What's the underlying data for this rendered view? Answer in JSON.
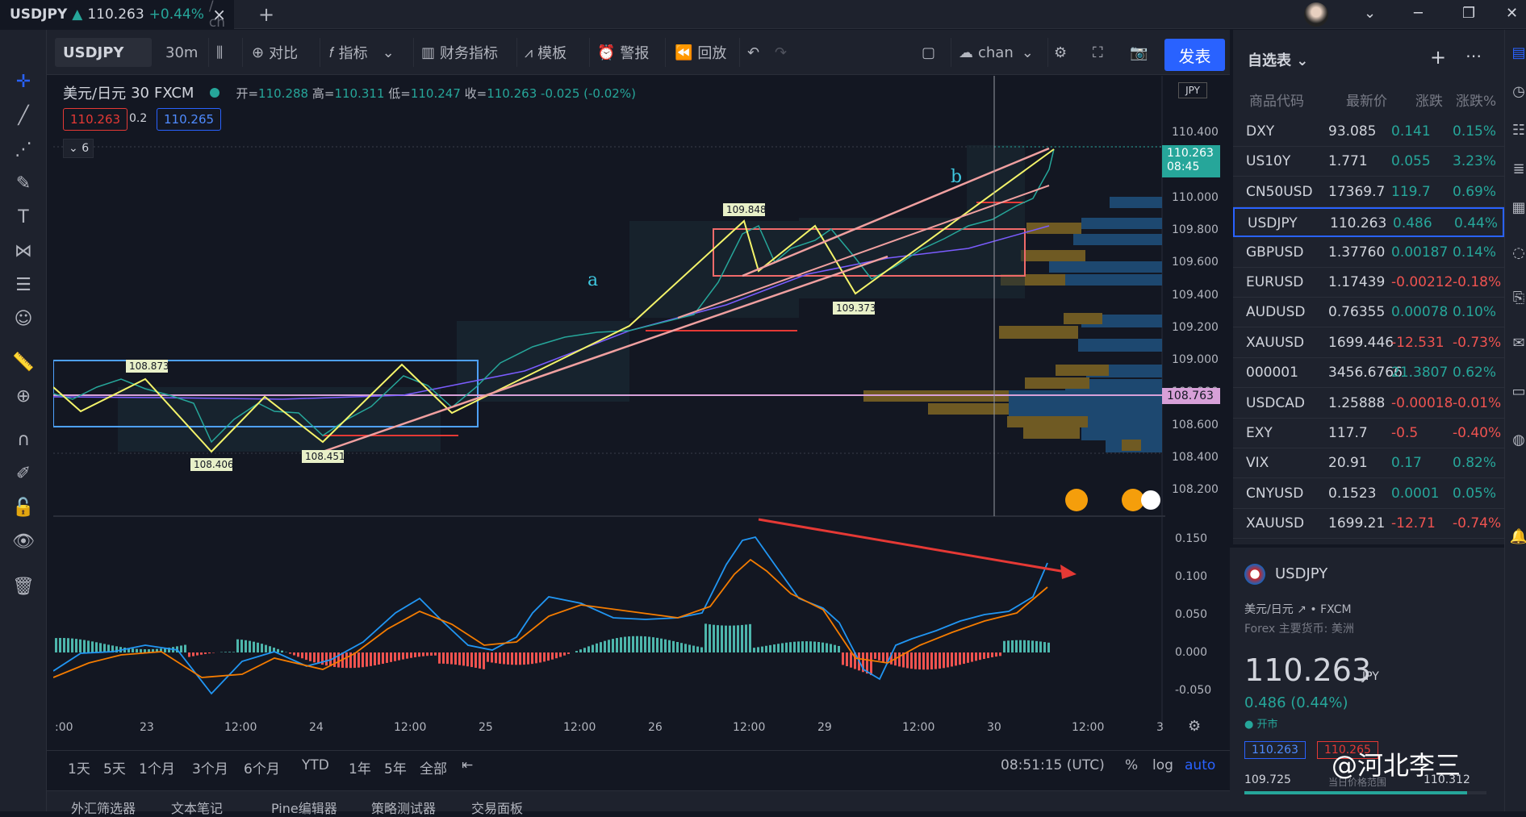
{
  "tab": {
    "symbol": "USDJPY",
    "arrow": "▲",
    "price": "110.263",
    "change": "+0.44%",
    "rest": "/ ch",
    "close": "×",
    "new": "+"
  },
  "window": {
    "minimize": "─",
    "restore": "❐",
    "close": "✕",
    "chevron": "⌄"
  },
  "toolbar": {
    "symbol": "USDJPY",
    "interval": "30m",
    "compare": "对比",
    "indicators": "指标",
    "financials": "财务指标",
    "templates": "模板",
    "alerts": "警报",
    "replay": "回放",
    "layout": "chan",
    "publish": "发表"
  },
  "legend": {
    "name": "美元/日元",
    "interval": "30",
    "source": "FXCM",
    "open_label": "开=",
    "open": "110.288",
    "high_label": "高=",
    "high": "110.311",
    "low_label": "低=",
    "low": "110.247",
    "close_label": "收=",
    "close": "110.263",
    "change": "-0.025 (-0.02%)",
    "bid": "110.263",
    "spread": "0.2",
    "ask": "110.265",
    "collapse": "6"
  },
  "price_axis": {
    "currency": "JPY",
    "labels": [
      "110.400",
      "110.200",
      "110.000",
      "109.800",
      "109.600",
      "109.400",
      "109.200",
      "109.000",
      "108.800",
      "108.600",
      "108.400",
      "108.200"
    ],
    "current": "110.263",
    "countdown": "08:45",
    "marker": "108.763"
  },
  "osc_axis": {
    "labels": [
      "0.150",
      "0.100",
      "0.050",
      "0.000",
      "-0.050"
    ]
  },
  "time_axis": {
    "labels": [
      ":00",
      "23",
      "12:00",
      "24",
      "12:00",
      "25",
      "12:00",
      "26",
      "12:00",
      "29",
      "12:00",
      "30",
      "12:00",
      "3"
    ]
  },
  "annotations": {
    "a": "a",
    "b": "b",
    "p1": "108.873",
    "p2": "108.406",
    "p3": "108.451",
    "p4": "109.848",
    "p5": "109.373"
  },
  "timebar": {
    "ranges": [
      "1天",
      "5天",
      "1个月",
      "3个月",
      "6个月",
      "YTD",
      "1年",
      "5年",
      "全部"
    ],
    "clock": "08:51:15 (UTC)",
    "pct": "%",
    "log": "log",
    "auto": "auto"
  },
  "bottom_tabs": [
    "外汇筛选器",
    "文本笔记",
    "Pine编辑器",
    "策略测试器",
    "交易面板"
  ],
  "watchlist": {
    "title": "自选表",
    "col_symbol": "商品代码",
    "col_last": "最新价",
    "col_chg": "涨跌",
    "col_chgp": "涨跌%",
    "rows": [
      {
        "sym": "DXY",
        "last": "93.085",
        "chg": "0.141",
        "chgp": "0.15%",
        "up": true
      },
      {
        "sym": "US10Y",
        "last": "1.771",
        "chg": "0.055",
        "chgp": "3.23%",
        "up": true
      },
      {
        "sym": "CN50USD",
        "last": "17369.7",
        "chg": "119.7",
        "chgp": "0.69%",
        "up": true
      },
      {
        "sym": "USDJPY",
        "last": "110.263",
        "chg": "0.486",
        "chgp": "0.44%",
        "up": true
      },
      {
        "sym": "GBPUSD",
        "last": "1.37760",
        "chg": "0.00187",
        "chgp": "0.14%",
        "up": true
      },
      {
        "sym": "EURUSD",
        "last": "1.17439",
        "chg": "-0.00212",
        "chgp": "-0.18%",
        "up": false
      },
      {
        "sym": "AUDUSD",
        "last": "0.76355",
        "chg": "0.00078",
        "chgp": "0.10%",
        "up": true
      },
      {
        "sym": "XAUUSD",
        "last": "1699.446",
        "chg": "-12.531",
        "chgp": "-0.73%",
        "up": false
      },
      {
        "sym": "000001",
        "last": "3456.6766",
        "chg": "21.3807",
        "chgp": "0.62%",
        "up": true
      },
      {
        "sym": "USDCAD",
        "last": "1.25888",
        "chg": "-0.00018",
        "chgp": "-0.01%",
        "up": false
      },
      {
        "sym": "EXY",
        "last": "117.7",
        "chg": "-0.5",
        "chgp": "-0.40%",
        "up": false
      },
      {
        "sym": "VIX",
        "last": "20.91",
        "chg": "0.17",
        "chgp": "0.82%",
        "up": true
      },
      {
        "sym": "CNYUSD",
        "last": "0.1523",
        "chg": "0.0001",
        "chgp": "0.05%",
        "up": true
      },
      {
        "sym": "XAUUSD",
        "last": "1699.21",
        "chg": "-12.71",
        "chgp": "-0.74%",
        "up": false
      }
    ]
  },
  "detail": {
    "symbol": "USDJPY",
    "name": "美元/日元",
    "source": "FXCM",
    "type": "Forex 主要货币: 美洲",
    "price": "110.263",
    "currency": "JPY",
    "change": "0.486 (0.44%)",
    "status": "开市",
    "bid": "110.263",
    "ask": "110.265",
    "low": "109.725",
    "high": "110.312",
    "range_label": "当日价格范围"
  },
  "watermark": "@河北李三"
}
